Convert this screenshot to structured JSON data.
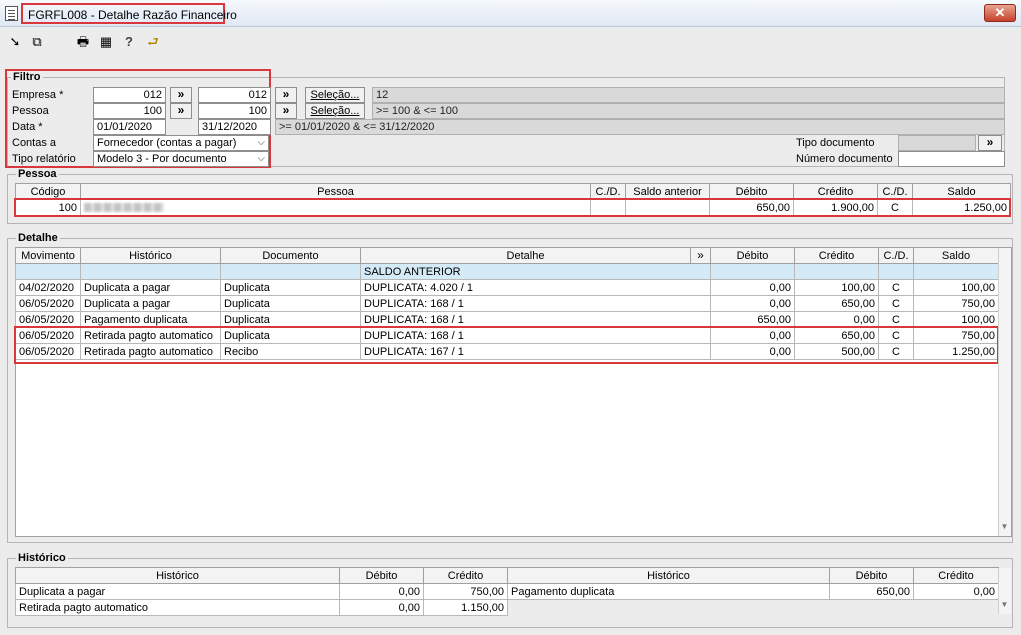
{
  "window": {
    "title": "FGRFL008 - Detalhe Razão Financeiro",
    "close": "✕"
  },
  "toolbar": {
    "icons": [
      "arrow-in-icon",
      "windows-icon",
      "print-icon",
      "calendar-icon",
      "help-icon",
      "exit-door-icon"
    ],
    "glyphs": [
      "➘",
      "⧉",
      "🖶",
      "▦",
      "?",
      "⮐"
    ]
  },
  "filtro": {
    "label": "Filtro",
    "empresa_label": "Empresa *",
    "empresa_from": "012",
    "empresa_to": "012",
    "pessoa_label": "Pessoa",
    "pessoa_from": "100",
    "pessoa_to": "100",
    "data_label": "Data *",
    "data_from": "01/01/2020",
    "data_to": "31/12/2020",
    "contas_label": "Contas a",
    "contas_value": "Fornecedor (contas a pagar)",
    "tipo_rel_label": "Tipo relatório",
    "tipo_rel_value": "Modelo 3 - Por documento",
    "chev": "»",
    "selecao_label": "Seleção...",
    "empresa_summary": "12",
    "pessoa_summary": ">= 100  &  <= 100",
    "data_summary": ">= 01/01/2020  &  <= 31/12/2020",
    "tipo_doc_label": "Tipo documento",
    "num_doc_label": "Número documento"
  },
  "pessoa": {
    "label": "Pessoa",
    "headers": [
      "Código",
      "Pessoa",
      "C./D.",
      "Saldo anterior",
      "Débito",
      "Crédito",
      "C./D.",
      "Saldo"
    ],
    "row": {
      "codigo": "100",
      "cd1": "",
      "saldo_anterior": "",
      "debito": "650,00",
      "credito": "1.900,00",
      "cd2": "C",
      "saldo": "1.250,00"
    }
  },
  "detalhe": {
    "label": "Detalhe",
    "headers": [
      "Movimento",
      "Histórico",
      "Documento",
      "Detalhe",
      "»",
      "Débito",
      "Crédito",
      "C./D.",
      "Saldo"
    ],
    "saldo_anterior_label": "SALDO ANTERIOR",
    "rows": [
      {
        "mov": "04/02/2020",
        "hist": "Duplicata a pagar",
        "doc": "Duplicata",
        "det": "DUPLICATA: 4.020 / 1",
        "deb": "0,00",
        "cred": "100,00",
        "cd": "C",
        "saldo": "100,00"
      },
      {
        "mov": "06/05/2020",
        "hist": "Duplicata a pagar",
        "doc": "Duplicata",
        "det": "DUPLICATA: 168 / 1",
        "deb": "0,00",
        "cred": "650,00",
        "cd": "C",
        "saldo": "750,00"
      },
      {
        "mov": "06/05/2020",
        "hist": "Pagamento duplicata",
        "doc": "Duplicata",
        "det": "DUPLICATA: 168 / 1",
        "deb": "650,00",
        "cred": "0,00",
        "cd": "C",
        "saldo": "100,00"
      },
      {
        "mov": "06/05/2020",
        "hist": "Retirada pagto automatico",
        "doc": "Duplicata",
        "det": "DUPLICATA: 168 / 1",
        "deb": "0,00",
        "cred": "650,00",
        "cd": "C",
        "saldo": "750,00"
      },
      {
        "mov": "06/05/2020",
        "hist": "Retirada pagto automatico",
        "doc": "Recibo",
        "det": "DUPLICATA: 167 / 1",
        "deb": "0,00",
        "cred": "500,00",
        "cd": "C",
        "saldo": "1.250,00"
      }
    ]
  },
  "historico": {
    "label": "Histórico",
    "headers": [
      "Histórico",
      "Débito",
      "Crédito",
      "Histórico",
      "Débito",
      "Crédito"
    ],
    "left_rows": [
      {
        "hist": "Duplicata a pagar",
        "deb": "0,00",
        "cred": "750,00"
      },
      {
        "hist": "Retirada pagto automatico",
        "deb": "0,00",
        "cred": "1.150,00"
      }
    ],
    "right_rows": [
      {
        "hist": "Pagamento duplicata",
        "deb": "650,00",
        "cred": "0,00"
      }
    ]
  },
  "colors": {
    "highlight_border": "#d9373c",
    "selected_row": "#d4ebf7"
  }
}
